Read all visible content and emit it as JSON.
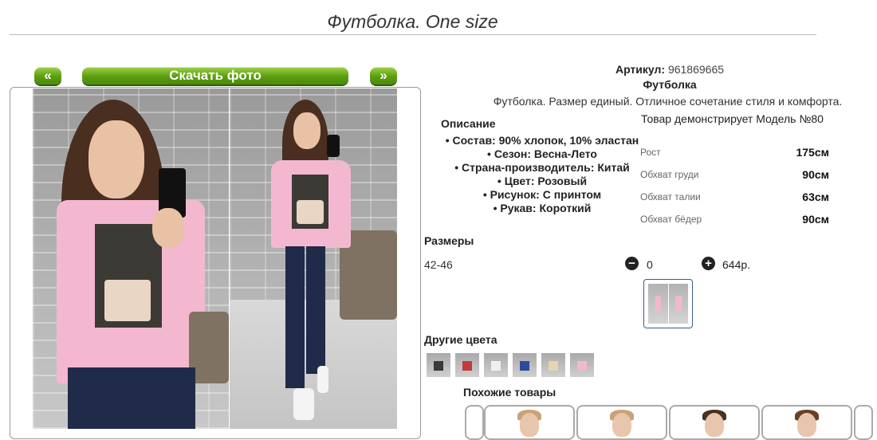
{
  "page": {
    "title": "Футболка. One size"
  },
  "gallery": {
    "prev_label": "«",
    "next_label": "»",
    "download_label": "Скачать фото"
  },
  "product": {
    "sku_label": "Артикул:",
    "sku_value": "961869665",
    "name": "Футболка",
    "description": "Футболка. Размер единый. Отличное сочетание стиля и комфорта.",
    "model_line": "Товар демонстрирует Модель №80"
  },
  "description_section": {
    "heading": "Описание",
    "attributes": [
      "Состав: 90% хлопок, 10% эластан",
      "Сезон: Весна-Лето",
      "Страна-производитель: Китай",
      "Цвет: Розовый",
      "Рисунок: С принтом",
      "Рукав: Короткий"
    ]
  },
  "measurements": [
    {
      "label": "Рост",
      "value": "175см"
    },
    {
      "label": "Обхват груди",
      "value": "90см"
    },
    {
      "label": "Обхват талии",
      "value": "63см"
    },
    {
      "label": "Обхват бёдер",
      "value": "90см"
    }
  ],
  "sizes": {
    "heading": "Размеры",
    "size": "42-46",
    "minus_icon": "minus-circle-icon",
    "plus_icon": "plus-circle-icon",
    "quantity": "0",
    "price": "644р."
  },
  "other_colors": {
    "heading": "Другие цвета",
    "swatch_colors": [
      "#3a3a3a",
      "#c23b3b",
      "#f0f0f0",
      "#2c4c9a",
      "#e3d7b0",
      "#f3b8cf"
    ]
  },
  "similar": {
    "heading": "Похожие товары"
  },
  "colors": {
    "accent_green": "#5c9d10",
    "shirt_pink": "#f3b8cf"
  }
}
